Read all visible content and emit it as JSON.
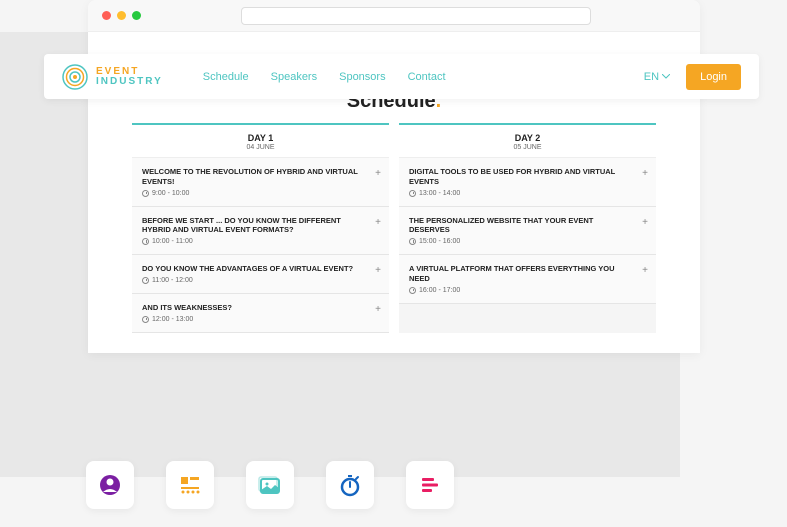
{
  "logo": {
    "event": "EVENT",
    "industry": "INDUSTRY"
  },
  "nav": {
    "schedule": "Schedule",
    "speakers": "Speakers",
    "sponsors": "Sponsors",
    "contact": "Contact"
  },
  "lang": "EN",
  "login": "Login",
  "page_title": "Schedule",
  "days": [
    {
      "label": "DAY 1",
      "date": "04 JUNE",
      "sessions": [
        {
          "title": "WELCOME TO THE REVOLUTION OF HYBRID AND VIRTUAL EVENTS!",
          "time": "9:00 - 10:00"
        },
        {
          "title": "BEFORE WE START ... DO YOU KNOW THE DIFFERENT HYBRID AND VIRTUAL EVENT FORMATS?",
          "time": "10:00 - 11:00"
        },
        {
          "title": "DO YOU KNOW THE ADVANTAGES OF A VIRTUAL EVENT?",
          "time": "11:00 - 12:00"
        },
        {
          "title": "AND ITS WEAKNESSES?",
          "time": "12:00 - 13:00"
        }
      ]
    },
    {
      "label": "DAY 2",
      "date": "05 JUNE",
      "sessions": [
        {
          "title": "DIGITAL TOOLS TO BE USED FOR HYBRID AND VIRTUAL EVENTS",
          "time": "13:00 - 14:00"
        },
        {
          "title": "THE PERSONALIZED WEBSITE THAT YOUR EVENT DESERVES",
          "time": "15:00 - 16:00"
        },
        {
          "title": "A VIRTUAL PLATFORM THAT OFFERS EVERYTHING YOU NEED",
          "time": "16:00 - 17:00"
        }
      ]
    }
  ]
}
